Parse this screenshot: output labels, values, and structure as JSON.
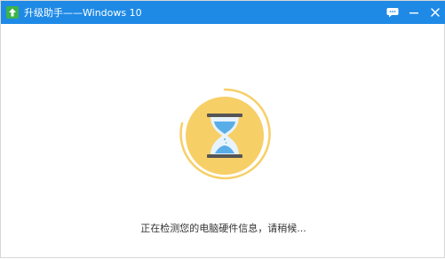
{
  "window": {
    "title": "升级助手——Windows 10",
    "titlebar_color": "#1f8ae6"
  },
  "title_controls": {
    "feedback_icon": "chat-bubble-icon",
    "minimize_icon": "minimize-icon",
    "close_icon": "close-icon"
  },
  "status": {
    "message": "正在检测您的电脑硬件信息，请稍候..."
  },
  "loader": {
    "icon": "hourglass-icon",
    "circle_color": "#f7cf67",
    "ring_color": "#f7cf67",
    "glass_color": "#e8f3fb",
    "sand_color": "#5aaee8",
    "frame_color": "#555555"
  }
}
